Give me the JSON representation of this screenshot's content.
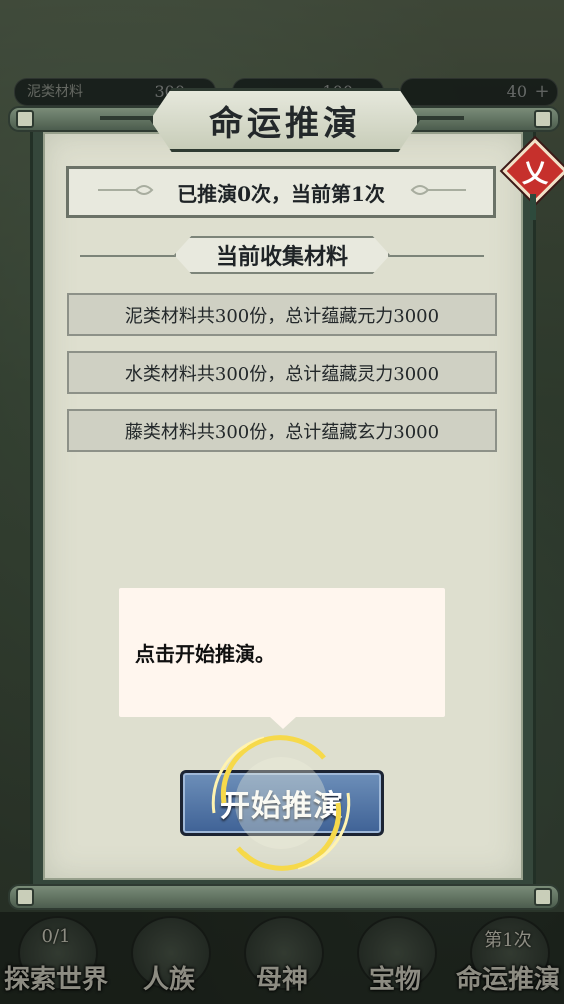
{
  "resources": [
    {
      "label": "泥类材料",
      "value": "300"
    },
    {
      "label": "",
      "value": "100"
    },
    {
      "label": "",
      "value": "40",
      "plus": "+"
    }
  ],
  "dialog": {
    "title": "命运推演",
    "close_icon_char": "乂",
    "count_text": "已推演0次，当前第1次",
    "section_title": "当前收集材料",
    "materials": [
      "泥类材料共300份，总计蕴藏元力3000",
      "水类材料共300份，总计蕴藏灵力3000",
      "藤类材料共300份，总计蕴藏玄力3000"
    ],
    "start_button": "开始推演"
  },
  "tooltip": {
    "text": "点击开始推演。"
  },
  "nav": [
    {
      "label": "探索世界",
      "sub": "0/1"
    },
    {
      "label": "人族",
      "sub": ""
    },
    {
      "label": "母神",
      "sub": ""
    },
    {
      "label": "宝物",
      "sub": ""
    },
    {
      "label": "命运推演",
      "sub": "第1次"
    }
  ],
  "colors": {
    "accent_button": "#4a6d9f",
    "close_button": "#c6302c",
    "highlight_ring": "#f6d94a"
  }
}
